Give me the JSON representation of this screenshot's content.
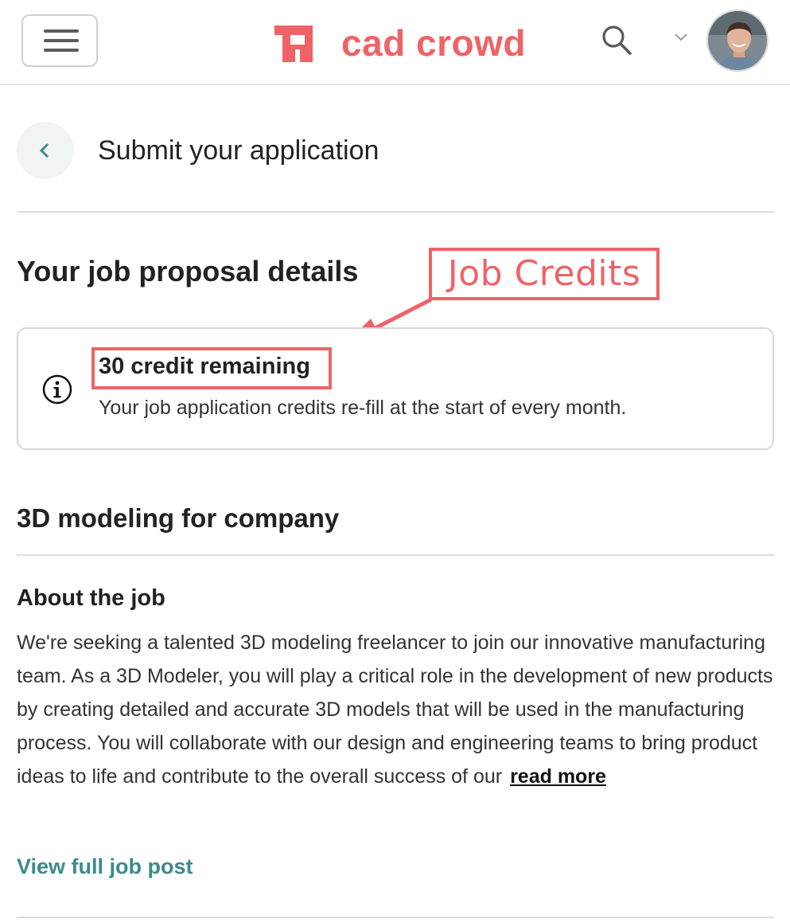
{
  "header": {
    "logo_text": "cad crowd",
    "brand_color": "#ef6366"
  },
  "title_row": {
    "title": "Submit your application"
  },
  "proposal": {
    "heading": "Your job proposal details",
    "annotation": "Job Credits",
    "credits_title": "30 credit remaining",
    "credits_note": "Your job application credits re-fill at the start of every month."
  },
  "job": {
    "title": "3D modeling for company",
    "about_heading": "About the job",
    "about_text": "We're seeking a talented 3D modeling freelancer to join our innovative manufacturing team. As a 3D Modeler, you will play a critical role in the development of new products by creating detailed and accurate 3D models that will be used in the manufacturing process. You will collaborate with our design and engineering teams to bring product ideas to life and contribute to the overall success of our",
    "read_more": "read more",
    "view_full": "View full job post",
    "link_color": "#3c8b8c"
  },
  "icons": [
    "hamburger-menu-icon",
    "logo-icon",
    "search-icon",
    "chevron-down-icon",
    "avatar",
    "back-chevron-icon",
    "info-icon"
  ]
}
